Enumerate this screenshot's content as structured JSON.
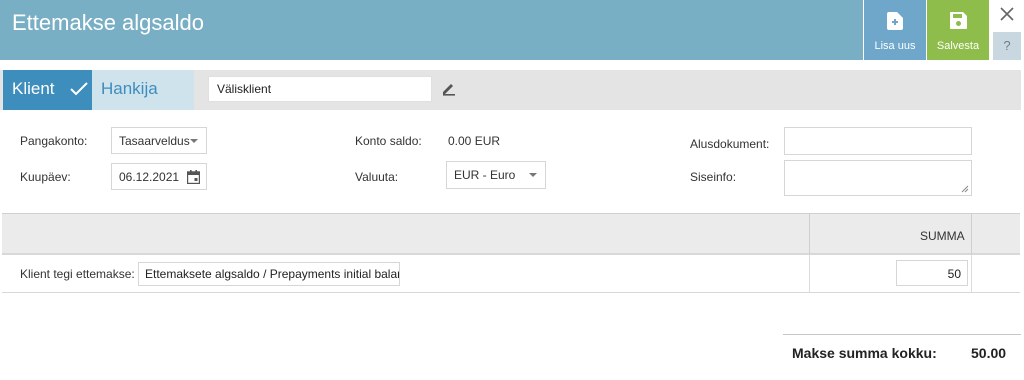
{
  "header": {
    "title": "Ettemakse algsaldo",
    "new_label": "Lisa uus",
    "save_label": "Salvesta",
    "help_label": "?"
  },
  "colors": {
    "header_bg": "#79afc4",
    "new_button": "#6ea7c9",
    "save_button": "#8ebd4b",
    "active_tab": "#3d8dbd"
  },
  "tabs": {
    "klient": "Klient",
    "hankija": "Hankija",
    "party_value": "Välisklient"
  },
  "form": {
    "pangakonto_label": "Pangakonto:",
    "pangakonto_value": "Tasaarveldus",
    "kuupaev_label": "Kuupäev:",
    "kuupaev_value": "06.12.2021",
    "konto_saldo_label": "Konto saldo:",
    "konto_saldo_value": "0.00 EUR",
    "valuuta_label": "Valuuta:",
    "valuuta_value": "EUR - Euro",
    "alusdokument_label": "Alusdokument:",
    "alusdokument_value": "",
    "siseinfo_label": "Siseinfo:",
    "siseinfo_value": ""
  },
  "grid": {
    "summa_header": "SUMMA",
    "rows": [
      {
        "label": "Klient tegi ettemakse:",
        "account": "Ettemaksete algsaldo / Prepayments initial balance",
        "amount": "50"
      }
    ]
  },
  "total": {
    "label": "Makse summa kokku:",
    "value": "50.00"
  },
  "icons": [
    "file-plus-icon",
    "save-icon",
    "close-icon",
    "checkmark-icon",
    "pencil-icon",
    "calendar-icon",
    "chevron-down-icon",
    "resize-handle-icon"
  ]
}
